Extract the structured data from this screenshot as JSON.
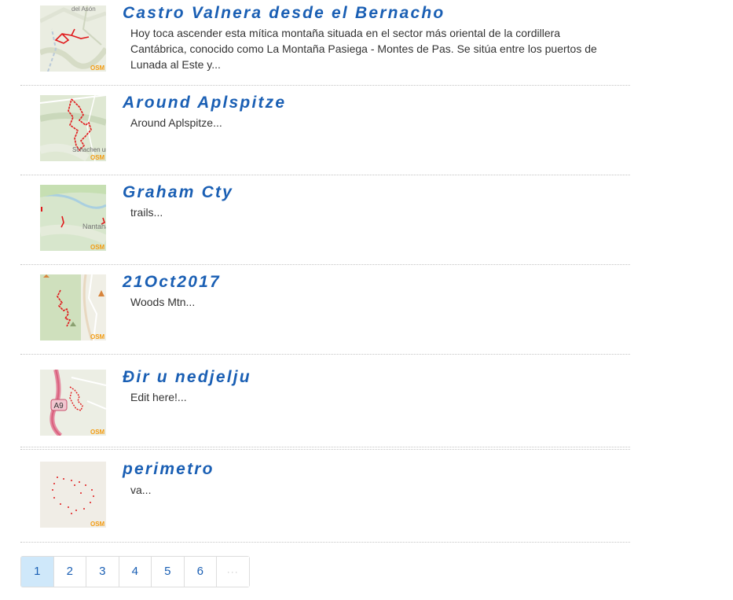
{
  "trails": [
    {
      "title": "Castro Valnera desde el Bernacho",
      "description": "Hoy toca ascender esta mítica montaña situada en el sector más oriental de la cordillera Cantábrica, conocido como La Montaña Pasiega - Montes de Pas. Se sitúa entre los puertos de Lunada al Este y...",
      "map_label": "del Asón",
      "osm_label": "OSM"
    },
    {
      "title": "Around Aplspitze",
      "description": "Around Aplspitze...",
      "map_label": "Schachen und Reith",
      "osm_label": "OSM"
    },
    {
      "title": "Graham Cty",
      "description": "trails...",
      "map_label": "Nantahala National",
      "osm_label": "OSM"
    },
    {
      "title": "21Oct2017",
      "description": "Woods Mtn...",
      "map_label": "",
      "osm_label": "OSM"
    },
    {
      "title": "Đir u nedjelju",
      "description": "Edit here!...",
      "map_label": "A9",
      "osm_label": "OSM"
    },
    {
      "title": "perimetro",
      "description": "va...",
      "map_label": "",
      "osm_label": "OSM"
    }
  ],
  "pagination": {
    "pages": [
      "1",
      "2",
      "3",
      "4",
      "5",
      "6",
      "···"
    ],
    "current": "1"
  },
  "colors": {
    "link": "#1a5fb4",
    "track": "#e0191b",
    "active_page_bg": "#cfe8fa"
  }
}
